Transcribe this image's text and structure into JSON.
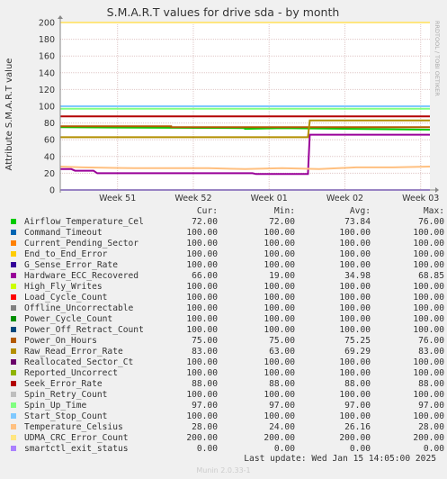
{
  "chart_data": {
    "type": "line",
    "title": "S.M.A.R.T values for drive sda - by month",
    "ylabel": "Attribute S.M.A.R.T value",
    "xlabel": "",
    "ylim": [
      0,
      200
    ],
    "yticks": [
      0,
      20,
      40,
      60,
      80,
      100,
      120,
      140,
      160,
      180,
      200
    ],
    "xticks": [
      "Week 51",
      "Week 52",
      "Week 01",
      "Week 02",
      "Week 03"
    ],
    "watermark": "RRDTOOL / TOBI OETIKER",
    "legend_headers": [
      "Cur:",
      "Min:",
      "Avg:",
      "Max:"
    ],
    "series": [
      {
        "name": "Airflow_Temperature_Cel",
        "color": "#00cc00",
        "cur": "72.00",
        "min": "72.00",
        "avg": "73.84",
        "max": "76.00",
        "points": [
          [
            0,
            75
          ],
          [
            0.5,
            74
          ],
          [
            0.5,
            73
          ],
          [
            0.6,
            74
          ],
          [
            1,
            72
          ]
        ]
      },
      {
        "name": "Command_Timeout",
        "color": "#0066b3",
        "cur": "100.00",
        "min": "100.00",
        "avg": "100.00",
        "max": "100.00",
        "points": [
          [
            0,
            100
          ],
          [
            1,
            100
          ]
        ]
      },
      {
        "name": "Current_Pending_Sector",
        "color": "#ff8000",
        "cur": "100.00",
        "min": "100.00",
        "avg": "100.00",
        "max": "100.00",
        "points": [
          [
            0,
            100
          ],
          [
            1,
            100
          ]
        ]
      },
      {
        "name": "End_to_End_Error",
        "color": "#ffcc00",
        "cur": "100.00",
        "min": "100.00",
        "avg": "100.00",
        "max": "100.00",
        "points": [
          [
            0,
            100
          ],
          [
            1,
            100
          ]
        ]
      },
      {
        "name": "G_Sense_Error_Rate",
        "color": "#330099",
        "cur": "100.00",
        "min": "100.00",
        "avg": "100.00",
        "max": "100.00",
        "points": [
          [
            0,
            100
          ],
          [
            1,
            100
          ]
        ]
      },
      {
        "name": "Hardware_ECC_Recovered",
        "color": "#990099",
        "cur": "66.00",
        "min": "19.00",
        "avg": "34.98",
        "max": "68.85",
        "points": [
          [
            0,
            25
          ],
          [
            0.03,
            25
          ],
          [
            0.04,
            23
          ],
          [
            0.09,
            23
          ],
          [
            0.1,
            20
          ],
          [
            0.52,
            20
          ],
          [
            0.53,
            19
          ],
          [
            0.67,
            19
          ],
          [
            0.675,
            66
          ],
          [
            1,
            66
          ]
        ]
      },
      {
        "name": "High_Fly_Writes",
        "color": "#ccff00",
        "cur": "100.00",
        "min": "100.00",
        "avg": "100.00",
        "max": "100.00",
        "points": [
          [
            0,
            100
          ],
          [
            1,
            100
          ]
        ]
      },
      {
        "name": "Load_Cycle_Count",
        "color": "#ff0000",
        "cur": "100.00",
        "min": "100.00",
        "avg": "100.00",
        "max": "100.00",
        "points": [
          [
            0,
            100
          ],
          [
            1,
            100
          ]
        ]
      },
      {
        "name": "Offline_Uncorrectable",
        "color": "#808080",
        "cur": "100.00",
        "min": "100.00",
        "avg": "100.00",
        "max": "100.00",
        "points": [
          [
            0,
            100
          ],
          [
            1,
            100
          ]
        ]
      },
      {
        "name": "Power_Cycle_Count",
        "color": "#008f00",
        "cur": "100.00",
        "min": "100.00",
        "avg": "100.00",
        "max": "100.00",
        "points": [
          [
            0,
            100
          ],
          [
            1,
            100
          ]
        ]
      },
      {
        "name": "Power_Off_Retract_Count",
        "color": "#00487d",
        "cur": "100.00",
        "min": "100.00",
        "avg": "100.00",
        "max": "100.00",
        "points": [
          [
            0,
            100
          ],
          [
            1,
            100
          ]
        ]
      },
      {
        "name": "Power_On_Hours",
        "color": "#b35a00",
        "cur": "75.00",
        "min": "75.00",
        "avg": "75.25",
        "max": "76.00",
        "points": [
          [
            0,
            76
          ],
          [
            0.3,
            76
          ],
          [
            0.3,
            75
          ],
          [
            1,
            75
          ]
        ]
      },
      {
        "name": "Raw_Read_Error_Rate",
        "color": "#b38f00",
        "cur": "83.00",
        "min": "63.00",
        "avg": "69.29",
        "max": "83.00",
        "points": [
          [
            0,
            63
          ],
          [
            0.67,
            63
          ],
          [
            0.675,
            83
          ],
          [
            1,
            83
          ]
        ]
      },
      {
        "name": "Reallocated_Sector_Ct",
        "color": "#6b006b",
        "cur": "100.00",
        "min": "100.00",
        "avg": "100.00",
        "max": "100.00",
        "points": [
          [
            0,
            100
          ],
          [
            1,
            100
          ]
        ]
      },
      {
        "name": "Reported_Uncorrect",
        "color": "#8fb300",
        "cur": "100.00",
        "min": "100.00",
        "avg": "100.00",
        "max": "100.00",
        "points": [
          [
            0,
            100
          ],
          [
            1,
            100
          ]
        ]
      },
      {
        "name": "Seek_Error_Rate",
        "color": "#b30000",
        "cur": "88.00",
        "min": "88.00",
        "avg": "88.00",
        "max": "88.00",
        "points": [
          [
            0,
            88
          ],
          [
            1,
            88
          ]
        ]
      },
      {
        "name": "Spin_Retry_Count",
        "color": "#bebebe",
        "cur": "100.00",
        "min": "100.00",
        "avg": "100.00",
        "max": "100.00",
        "points": [
          [
            0,
            100
          ],
          [
            1,
            100
          ]
        ]
      },
      {
        "name": "Spin_Up_Time",
        "color": "#80ff80",
        "cur": "97.00",
        "min": "97.00",
        "avg": "97.00",
        "max": "97.00",
        "points": [
          [
            0,
            97
          ],
          [
            1,
            97
          ]
        ]
      },
      {
        "name": "Start_Stop_Count",
        "color": "#80c9ff",
        "cur": "100.00",
        "min": "100.00",
        "avg": "100.00",
        "max": "100.00",
        "points": [
          [
            0,
            100
          ],
          [
            1,
            100
          ]
        ]
      },
      {
        "name": "Temperature_Celsius",
        "color": "#ffc080",
        "cur": "28.00",
        "min": "24.00",
        "avg": "26.16",
        "max": "28.00",
        "points": [
          [
            0,
            28
          ],
          [
            0.06,
            27
          ],
          [
            0.2,
            26
          ],
          [
            0.4,
            26
          ],
          [
            0.5,
            25
          ],
          [
            0.6,
            26
          ],
          [
            0.7,
            25
          ],
          [
            0.8,
            27
          ],
          [
            0.9,
            27
          ],
          [
            1,
            28
          ]
        ]
      },
      {
        "name": "UDMA_CRC_Error_Count",
        "color": "#ffe680",
        "cur": "200.00",
        "min": "200.00",
        "avg": "200.00",
        "max": "200.00",
        "points": [
          [
            0,
            200
          ],
          [
            1,
            200
          ]
        ]
      },
      {
        "name": "smartctl_exit_status",
        "color": "#aa80ff",
        "cur": "0.00",
        "min": "0.00",
        "avg": "0.00",
        "max": "0.00",
        "points": [
          [
            0,
            0
          ],
          [
            1,
            0
          ]
        ]
      }
    ]
  },
  "last_update": "Last update:  Wed Jan 15 14:05:00 2025",
  "footer": "Munin 2.0.33-1"
}
